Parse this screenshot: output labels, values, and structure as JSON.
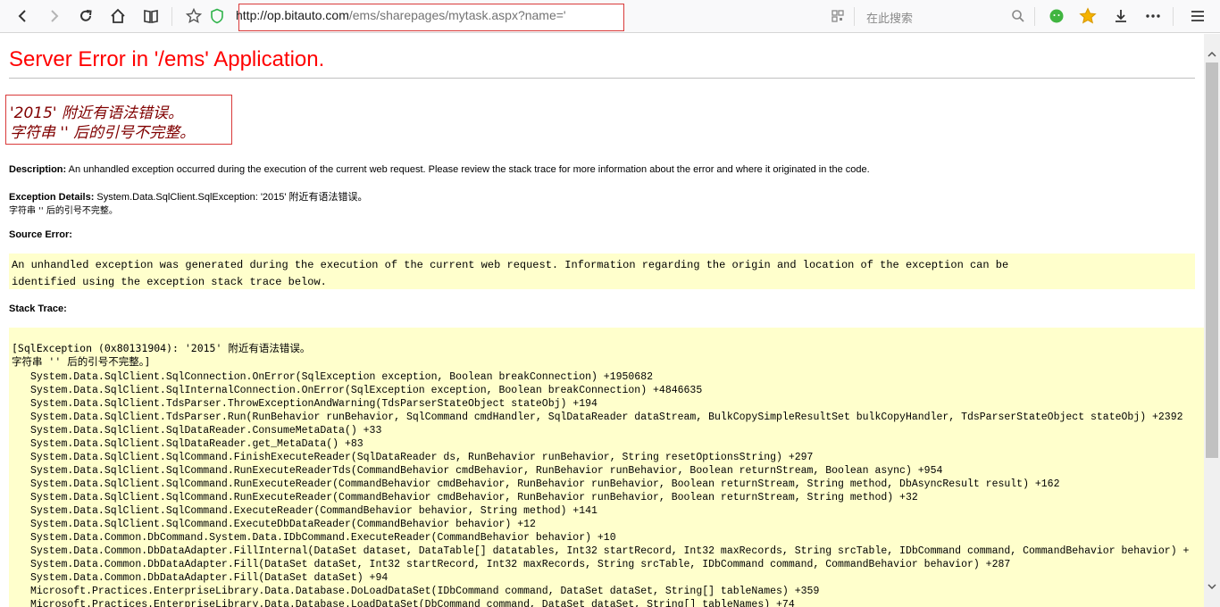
{
  "browser": {
    "url_host": "http://op.bitauto.com",
    "url_path": "/ems/sharepages/mytask.aspx?name='",
    "search_placeholder": "在此搜索",
    "icons": [
      "back-icon",
      "forward-icon",
      "reload-icon",
      "home-icon",
      "reader-icon",
      "bookmark-star-icon",
      "shield-icon",
      "qr-code-icon",
      "search-icon",
      "wechat-icon",
      "favorites-star-icon",
      "download-icon",
      "more-icon",
      "menu-icon"
    ],
    "accent_colors": {
      "favorites_star": "#f5b300",
      "shield": "#2fb34a",
      "wechat": "#40b540"
    }
  },
  "error": {
    "title": "Server Error in '/ems' Application.",
    "message": "'2015' 附近有语法错误。\n字符串 '' 后的引号不完整。",
    "description_label": "Description:",
    "description_text": " An unhandled exception occurred during the execution of the current web request. Please review the stack trace for more information about the error and where it originated in the code.",
    "exception_label": "Exception Details:",
    "exception_text": " System.Data.SqlClient.SqlException: '2015' 附近有语法错误。",
    "exception_text_line2": "字符串 '' 后的引号不完整。",
    "source_error_label": "Source Error:",
    "source_error_text": "An unhandled exception was generated during the execution of the current web request. Information regarding the origin and location of the exception can be\nidentified using the exception stack trace below.",
    "stack_trace_label": "Stack Trace:",
    "stack_head": "[SqlException (0x80131904): '2015' 附近有语法错误。\n字符串 '' 后的引号不完整。]",
    "stack_frames": [
      "System.Data.SqlClient.SqlConnection.OnError(SqlException exception, Boolean breakConnection) +1950682",
      "System.Data.SqlClient.SqlInternalConnection.OnError(SqlException exception, Boolean breakConnection) +4846635",
      "System.Data.SqlClient.TdsParser.ThrowExceptionAndWarning(TdsParserStateObject stateObj) +194",
      "System.Data.SqlClient.TdsParser.Run(RunBehavior runBehavior, SqlCommand cmdHandler, SqlDataReader dataStream, BulkCopySimpleResultSet bulkCopyHandler, TdsParserStateObject stateObj) +2392",
      "System.Data.SqlClient.SqlDataReader.ConsumeMetaData() +33",
      "System.Data.SqlClient.SqlDataReader.get_MetaData() +83",
      "System.Data.SqlClient.SqlCommand.FinishExecuteReader(SqlDataReader ds, RunBehavior runBehavior, String resetOptionsString) +297",
      "System.Data.SqlClient.SqlCommand.RunExecuteReaderTds(CommandBehavior cmdBehavior, RunBehavior runBehavior, Boolean returnStream, Boolean async) +954",
      "System.Data.SqlClient.SqlCommand.RunExecuteReader(CommandBehavior cmdBehavior, RunBehavior runBehavior, Boolean returnStream, String method, DbAsyncResult result) +162",
      "System.Data.SqlClient.SqlCommand.RunExecuteReader(CommandBehavior cmdBehavior, RunBehavior runBehavior, Boolean returnStream, String method) +32",
      "System.Data.SqlClient.SqlCommand.ExecuteReader(CommandBehavior behavior, String method) +141",
      "System.Data.SqlClient.SqlCommand.ExecuteDbDataReader(CommandBehavior behavior) +12",
      "System.Data.Common.DbCommand.System.Data.IDbCommand.ExecuteReader(CommandBehavior behavior) +10",
      "System.Data.Common.DbDataAdapter.FillInternal(DataSet dataset, DataTable[] datatables, Int32 startRecord, Int32 maxRecords, String srcTable, IDbCommand command, CommandBehavior behavior) +",
      "System.Data.Common.DbDataAdapter.Fill(DataSet dataSet, Int32 startRecord, Int32 maxRecords, String srcTable, IDbCommand command, CommandBehavior behavior) +287",
      "System.Data.Common.DbDataAdapter.Fill(DataSet dataSet) +94",
      "Microsoft.Practices.EnterpriseLibrary.Data.Database.DoLoadDataSet(IDbCommand command, DataSet dataSet, String[] tableNames) +359",
      "Microsoft.Practices.EnterpriseLibrary.Data.Database.LoadDataSet(DbCommand command, DataSet dataSet, String[] tableNames) +74"
    ]
  }
}
